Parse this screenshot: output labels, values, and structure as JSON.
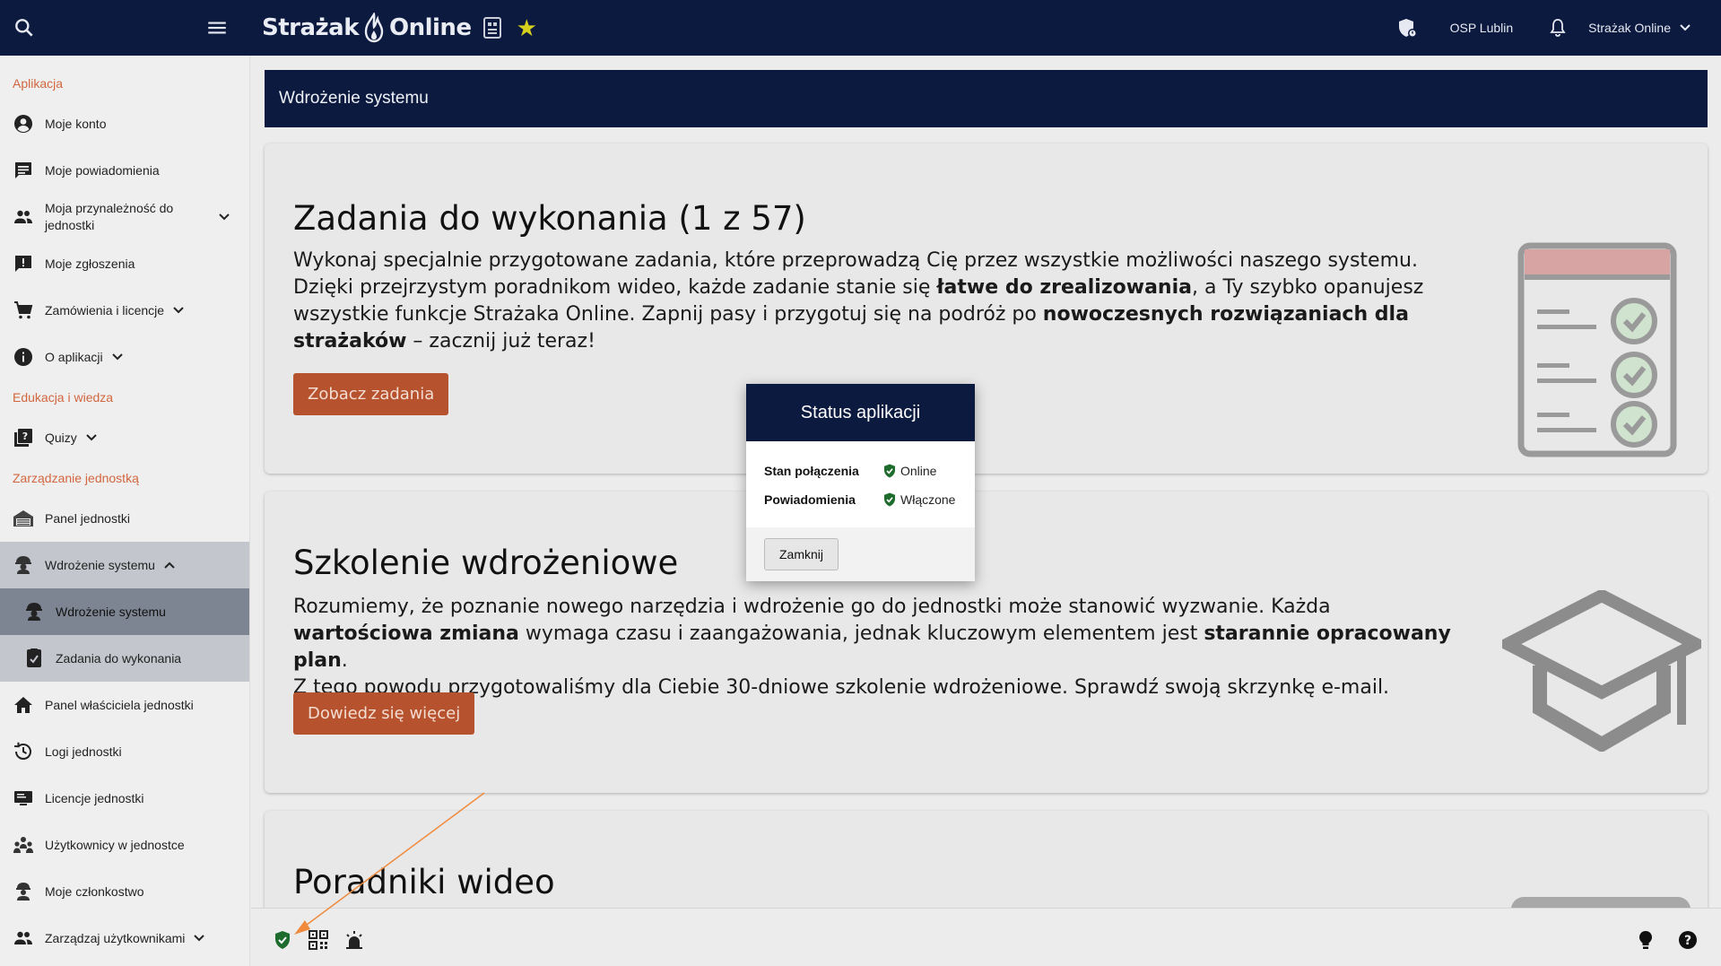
{
  "topbar": {
    "logo_text": "Strażak Online",
    "logo_part1": "Strażak",
    "logo_part2": "Online",
    "unit_name": "OSP Lublin",
    "user_name": "Strażak Online"
  },
  "sidebar": {
    "sections": {
      "app": "Aplikacja",
      "edu": "Edukacja i wiedza",
      "unit": "Zarządzanie jednostką"
    },
    "items": {
      "account": "Moje konto",
      "notifications": "Moje powiadomienia",
      "membership": "Moja przynależność do jednostki",
      "reports": "Moje zgłoszenia",
      "orders": "Zamówienia i licencje",
      "about": "O aplikacji",
      "quizzes": "Quizy",
      "unit_panel": "Panel jednostki",
      "deployment": "Wdrożenie systemu",
      "deployment_sub": "Wdrożenie systemu",
      "tasks": "Zadania do wykonania",
      "owner_panel": "Panel właściciela jednostki",
      "logs": "Logi jednostki",
      "licenses": "Licencje jednostki",
      "unit_users": "Użytkownicy w jednostce",
      "my_membership": "Moje członkostwo",
      "manage_users": "Zarządzaj użytkownikami"
    }
  },
  "page": {
    "header": "Wdrożenie systemu",
    "cards": [
      {
        "title": "Zadania do wykonania (1 z 57)",
        "text_1": "Wykonaj specjalnie przygotowane zadania, które przeprowadzą Cię przez wszystkie możliwości naszego systemu.",
        "text_2a": "Dzięki przejrzystym poradnikom wideo, każde zadanie stanie się ",
        "text_2b": "łatwe do zrealizowania",
        "text_2c": ", a Ty szybko opanujesz",
        "text_3a": "wszystkie funkcje Strażaka Online. Zapnij pasy i przygotuj się na podróż po ",
        "text_3b": "nowoczesnych rozwiązaniach dla",
        "text_4a": "strażaków",
        "text_4b": " – zacznij już teraz!",
        "button": "Zobacz zadania"
      },
      {
        "title": "Szkolenie wdrożeniowe",
        "text_1": "Rozumiemy, że poznanie nowego narzędzia i wdrożenie go do jednostki może stanowić wyzwanie. Każda",
        "text_2a": "wartościowa zmiana",
        "text_2b": " wymaga czasu i zaangażowania, jednak kluczowym elementem jest ",
        "text_2c": "starannie opracowany plan",
        "text_2d": ".",
        "text_3": "Z tego powodu przygotowaliśmy dla Ciebie 30-dniowe szkolenie wdrożeniowe. Sprawdź swoją skrzynkę e-mail.",
        "button": "Dowiedz się więcej"
      },
      {
        "title": "Poradniki wideo"
      }
    ]
  },
  "dialog": {
    "title": "Status aplikacji",
    "rows": [
      {
        "key": "Stan połączenia",
        "value": "Online"
      },
      {
        "key": "Powiadomienia",
        "value": "Włączone"
      }
    ],
    "close_label": "Zamknij"
  },
  "colors": {
    "navy": "#0c1a40",
    "accent_orange": "#b6522e",
    "section_orange": "#d2663f",
    "status_green": "#1e6b2e",
    "star_yellow": "#d5cf1e",
    "arrow_orange": "#f08a3c"
  },
  "icons": {
    "topbar": [
      "search-icon",
      "menu-icon",
      "shield-status-icon",
      "bell-icon",
      "chevron-down-icon"
    ],
    "bottombar": [
      "shield-check-icon",
      "qr-code-icon",
      "alarm-light-icon",
      "lightbulb-icon",
      "help-icon"
    ]
  }
}
